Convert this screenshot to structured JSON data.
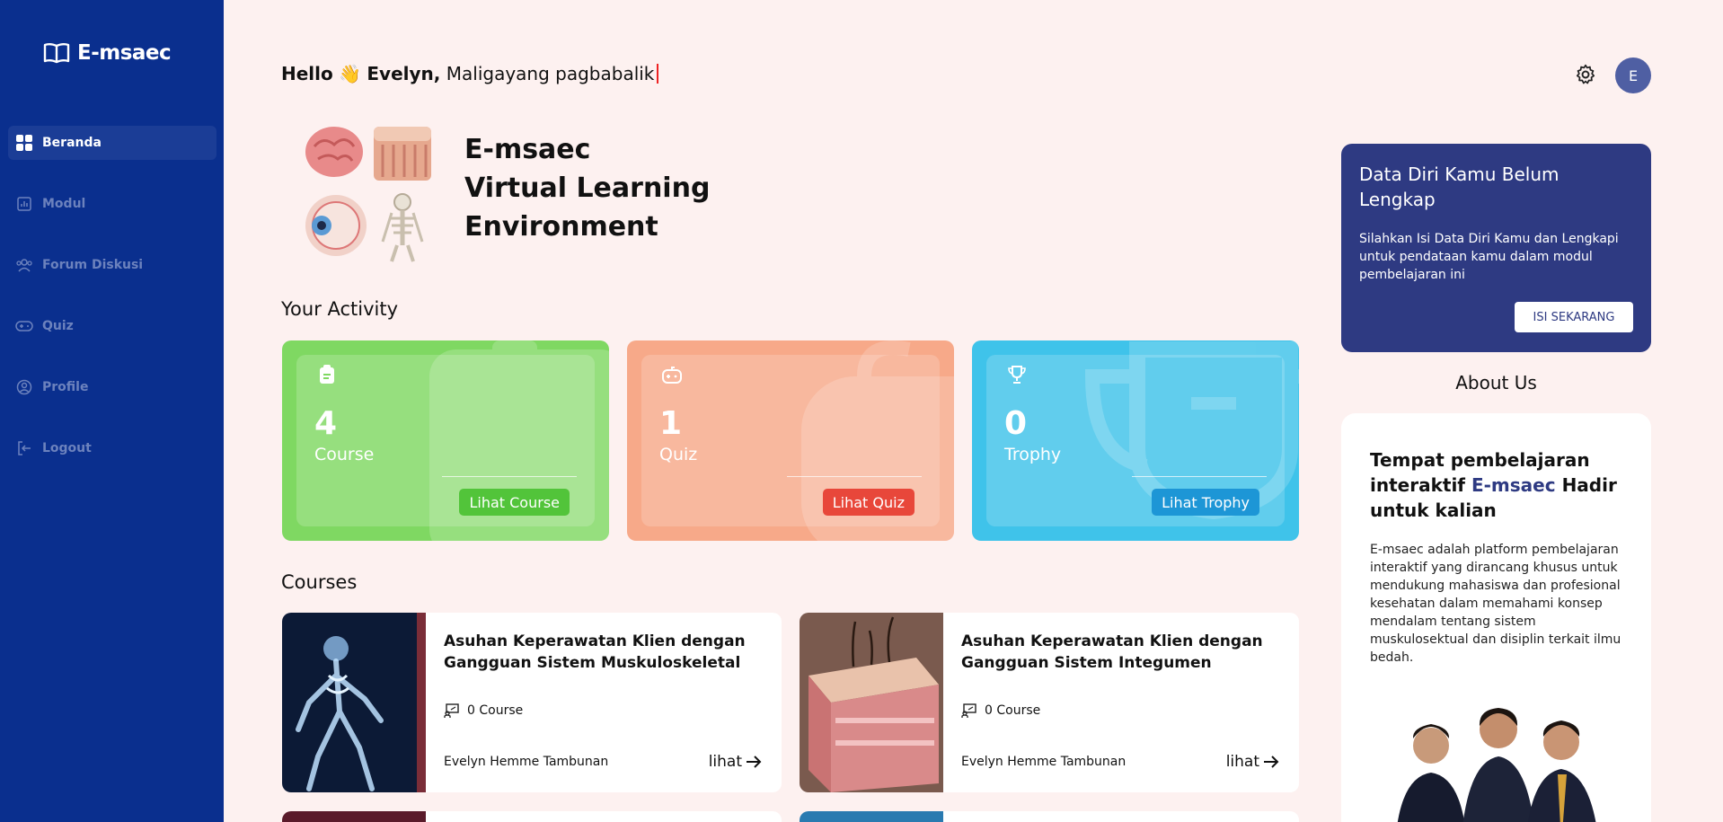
{
  "brand": {
    "name": "E-msaec"
  },
  "sidebar": {
    "items": [
      {
        "label": "Beranda",
        "icon": "grid-icon",
        "active": true
      },
      {
        "label": "Modul",
        "icon": "chart-icon"
      },
      {
        "label": "Forum Diskusi",
        "icon": "people-icon"
      },
      {
        "label": "Quiz",
        "icon": "gamepad-icon"
      },
      {
        "label": "Profile",
        "icon": "user-circle-icon"
      },
      {
        "label": "Logout",
        "icon": "logout-icon"
      }
    ]
  },
  "header": {
    "hello": "Hello",
    "wave": "👋",
    "name": "Evelyn,",
    "tagline": "Maligayang pagbabalik",
    "avatar_initial": "E"
  },
  "hero": {
    "line1": "E-msaec",
    "line2": "Virtual Learning",
    "line3": "Environment"
  },
  "activity": {
    "title": "Your Activity",
    "cards": [
      {
        "value": "4",
        "label": "Course",
        "button": "Lihat Course",
        "color": "#7fd862",
        "btn_color": "#52c43a"
      },
      {
        "value": "1",
        "label": "Quiz",
        "button": "Lihat Quiz",
        "color": "#f7a989",
        "btn_color": "#e8473a"
      },
      {
        "value": "0",
        "label": "Trophy",
        "button": "Lihat Trophy",
        "color": "#3fc3ea",
        "btn_color": "#1d96d6"
      }
    ]
  },
  "courses": {
    "title": "Courses",
    "items": [
      {
        "title": "Asuhan Keperawatan Klien dengan Gangguan Sistem Muskuloskeletal",
        "count": "0 Course",
        "author": "Evelyn Hemme Tambunan",
        "link": "lihat"
      },
      {
        "title": "Asuhan Keperawatan Klien dengan Gangguan Sistem Integumen",
        "count": "0 Course",
        "author": "Evelyn Hemme Tambunan",
        "link": "lihat"
      }
    ]
  },
  "notice": {
    "title": "Data Diri Kamu Belum Lengkap",
    "text": "Silahkan Isi Data Diri Kamu dan Lengkapi untuk pendataan kamu dalam modul pembelajaran ini",
    "button": "ISI SEKARANG"
  },
  "about": {
    "title": "About Us",
    "heading_pre": "Tempat pembelajaran interaktif",
    "heading_accent": "E-msaec",
    "heading_post": "Hadir untuk kalian",
    "text": "E-msaec adalah platform pembelajaran interaktif yang dirancang khusus untuk mendukung mahasiswa dan profesional kesehatan dalam memahami konsep mendalam tentang sistem muskulosektual dan disiplin terkait ilmu bedah."
  }
}
